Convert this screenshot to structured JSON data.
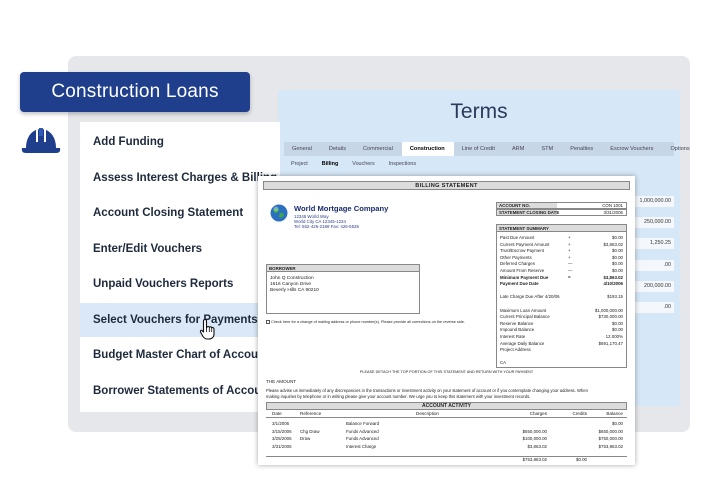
{
  "title": "Construction Loans",
  "menu": {
    "items": [
      "Add Funding",
      "Assess Interest Charges & Billing",
      "Account Closing Statement",
      "Enter/Edit Vouchers",
      "Unpaid Vouchers Reports",
      "Select Vouchers for Payments",
      "Budget Master Chart of Accounts",
      "Borrower Statements of Account"
    ],
    "active_index": 5
  },
  "terms": {
    "title": "Terms",
    "tabs": [
      "General",
      "Details",
      "Commercial",
      "Construction",
      "Line of Credit",
      "ARM",
      "STM",
      "Penalties",
      "Escrow Vouchers",
      "Options"
    ],
    "active_tab": "Construction",
    "subtabs": [
      "Project",
      "Billing",
      "Vouchers",
      "Inspections"
    ],
    "active_subtab": "Billing",
    "values": [
      "1,000,000.00",
      "250,000.00",
      "1,250.25",
      ".00",
      "200,000.00",
      ".00"
    ]
  },
  "bill": {
    "header": "BILLING STATEMENT",
    "company": {
      "name": "World Mortgage Company",
      "address1": "12345 World Way",
      "address2": "World City CA 12345-1234",
      "phone": "Tel: 562-426-2188  Fax: 426-5535"
    },
    "account": [
      {
        "label": "ACCOUNT NO.",
        "value": "CON 1001"
      },
      {
        "label": "STATEMENT CLOSING DATE",
        "value": "3/31/2006"
      }
    ],
    "summary_header": "STATEMENT SUMMARY",
    "summary": [
      {
        "label": "Past Due Amount",
        "op": "+",
        "value": "$0.00",
        "bold": false
      },
      {
        "label": "Current Payment Amount",
        "op": "+",
        "value": "$3,863.02",
        "bold": false
      },
      {
        "label": "Trust/Escrow Payment",
        "op": "+",
        "value": "$0.00",
        "bold": false
      },
      {
        "label": "Other Payments",
        "op": "+",
        "value": "$0.00",
        "bold": false
      },
      {
        "label": "Deferred Charges",
        "op": "—",
        "value": "$0.00",
        "bold": false
      },
      {
        "label": "Amount From Reserve",
        "op": "—",
        "value": "$0.00",
        "bold": false
      },
      {
        "label": "Minimum Payment Due",
        "op": "=",
        "value": "$3,863.02",
        "bold": true
      },
      {
        "label": "Payment Due Date",
        "op": "",
        "value": "4/10/2006",
        "bold": true
      },
      {
        "label": "",
        "op": "",
        "value": "",
        "bold": false
      },
      {
        "label": "Late Charge Due After 4/20/06",
        "op": "",
        "value": "$193.15",
        "bold": false
      },
      {
        "label": "",
        "op": "",
        "value": "",
        "bold": false
      },
      {
        "label": "Maximum Loan Amount",
        "op": "",
        "value": "$1,000,000.00",
        "bold": false
      },
      {
        "label": "Current Principal Balance",
        "op": "",
        "value": "$730,000.00",
        "bold": false
      },
      {
        "label": "Reserve Balance",
        "op": "",
        "value": "$0.00",
        "bold": false
      },
      {
        "label": "Impound Balance",
        "op": "",
        "value": "$0.00",
        "bold": false
      },
      {
        "label": "Interest Rate",
        "op": "",
        "value": "12.000%",
        "bold": false
      },
      {
        "label": "Average Daily Balance",
        "op": "",
        "value": "$691,170.47",
        "bold": false
      },
      {
        "label": "Project Address",
        "op": "",
        "value": "",
        "bold": false
      },
      {
        "label": "",
        "op": "",
        "value": "",
        "bold": false
      },
      {
        "label": "CA",
        "op": "",
        "value": "",
        "bold": false
      }
    ],
    "borrower": {
      "header": "BORROWER",
      "lines": [
        "John Q Construction",
        "1616 Canyon Drive",
        "Beverly Hills CA 90210"
      ]
    },
    "check_text": "Check here for a change of mailing address or phone number(s). Please provide all corrections on the reverse side.",
    "detach_text": "PLEASE DETACH THE TOP PORTION OF THIS STATEMENT AND RETURN WITH YOUR PAYMENT",
    "amount_label": "THE AMOUNT",
    "notes": [
      "Please advise us immediately of any discrepancies in the transactions or investment activity on your statement of account or if you contemplate changing your address.  When",
      "making inquiries by telephone or in writing please give your account number.  We urge you to keep this statement with your investment records."
    ],
    "activity": {
      "header": "ACCOUNT ACTIVITY",
      "columns": {
        "date": "Date",
        "ref": "Reference",
        "desc": "Description",
        "charges": "Charges",
        "credits": "Credits",
        "balance": "Balance"
      },
      "rows": [
        {
          "date": "3/1/2006",
          "ref": "",
          "desc": "Balance Forward",
          "charges": "",
          "credits": "",
          "balance": "$0.00"
        },
        {
          "date": "3/15/2006",
          "ref": "Chg Draw",
          "desc": "Funds Advanced",
          "charges": "$650,000.00",
          "credits": "",
          "balance": "$650,000.00"
        },
        {
          "date": "3/25/2006",
          "ref": "Draw",
          "desc": "Funds Advanced",
          "charges": "$100,000.00",
          "credits": "",
          "balance": "$750,000.00"
        },
        {
          "date": "3/31/2006",
          "ref": "",
          "desc": "Interest Charge",
          "charges": "$3,863.02",
          "credits": "",
          "balance": "$753,863.02"
        }
      ],
      "totals": {
        "charges": "$753,863.02",
        "credits": "$0.00"
      }
    }
  },
  "colors": {
    "brand": "#1f3e8c",
    "active_menu": "#dbe8f7",
    "terms_bg": "#d6e7f7"
  },
  "icons": [
    "hard-hat-icon",
    "hand-pointer-icon",
    "globe-logo-icon"
  ]
}
